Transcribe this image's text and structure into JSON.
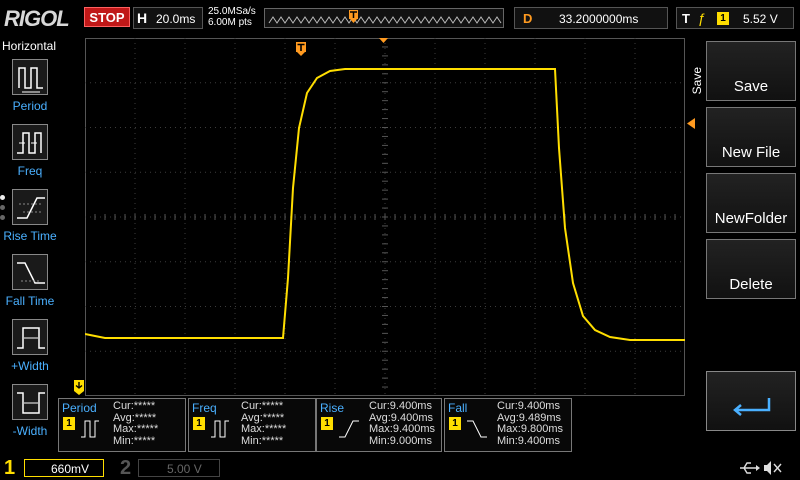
{
  "header": {
    "brand": "RIGOL",
    "run_state": "STOP",
    "horizontal": {
      "label": "H",
      "value": "20.0ms"
    },
    "sample_rate": "25.0MSa/s",
    "memory_depth": "6.00M pts",
    "delay": {
      "label": "D",
      "value": "33.2000000ms"
    },
    "trigger": {
      "label": "T",
      "slope_symbol": "ƒ",
      "source": "1",
      "level": "5.52 V"
    }
  },
  "left_menu": {
    "title": "Horizontal",
    "items": [
      {
        "label": "Period",
        "icon": "period-icon"
      },
      {
        "label": "Freq",
        "icon": "frequency-icon"
      },
      {
        "label": "Rise Time",
        "icon": "rise-time-icon"
      },
      {
        "label": "Fall Time",
        "icon": "fall-time-icon"
      },
      {
        "label": "+Width",
        "icon": "positive-width-icon"
      },
      {
        "label": "-Width",
        "icon": "negative-width-icon"
      }
    ]
  },
  "right_menu": {
    "title": "Save",
    "buttons": [
      {
        "label": "Save"
      },
      {
        "label": "New File"
      },
      {
        "label": "NewFolder"
      },
      {
        "label": "Delete"
      }
    ],
    "enter_icon": "enter-icon"
  },
  "measurements": [
    {
      "name": "Period",
      "channel": "1",
      "cur": "Cur:*****",
      "avg": "Avg:*****",
      "max": "Max:*****",
      "min": "Min:*****"
    },
    {
      "name": "Freq",
      "channel": "1",
      "cur": "Cur:*****",
      "avg": "Avg:*****",
      "max": "Max:*****",
      "min": "Min:*****"
    },
    {
      "name": "Rise",
      "channel": "1",
      "cur": "Cur:9.400ms",
      "avg": "Avg:9.400ms",
      "max": "Max:9.400ms",
      "min": "Min:9.000ms"
    },
    {
      "name": "Fall",
      "channel": "1",
      "cur": "Cur:9.400ms",
      "avg": "Avg:9.489ms",
      "max": "Max:9.800ms",
      "min": "Min:9.400ms"
    }
  ],
  "channels": [
    {
      "number": "1",
      "scale": "660mV",
      "color": "#ffde00"
    },
    {
      "number": "2",
      "scale": "5.00 V",
      "color": "#555555"
    }
  ],
  "colors": {
    "trace": "#ffde00",
    "accent_blue": "#4ab0ff",
    "trigger_orange": "#ff9a20",
    "stop_red": "#c01818"
  },
  "bottom_icons": [
    "usb-icon",
    "speaker-mute-icon"
  ]
}
